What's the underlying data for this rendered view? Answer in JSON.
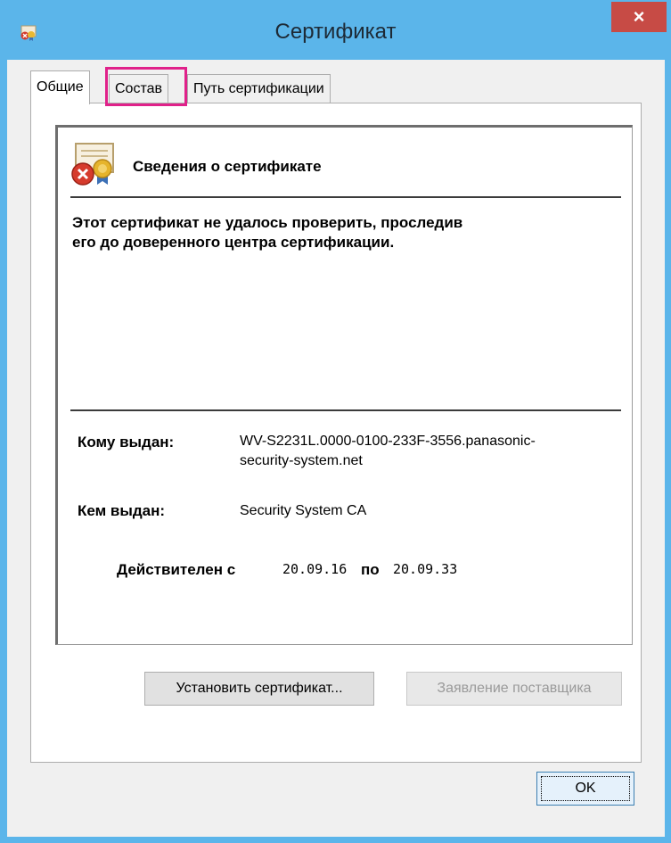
{
  "window": {
    "title": "Сертификат",
    "close_label": "×",
    "colors": {
      "frame": "#5bb5ea",
      "close": "#c74b45",
      "highlight": "#e0218a"
    }
  },
  "tabs": [
    {
      "label": "Общие",
      "active": true
    },
    {
      "label": "Состав",
      "active": false,
      "highlighted": true
    },
    {
      "label": "Путь сертификации",
      "active": false
    }
  ],
  "info": {
    "header": "Сведения о сертификате",
    "warning_line1": "Этот сертификат не удалось проверить, проследив",
    "warning_line2": "его до доверенного центра сертификации.",
    "issued_to_label": "Кому выдан:",
    "issued_to_line1": "WV-S2231L.0000-0100-233F-3556.panasonic-",
    "issued_to_line2": "security-system.net",
    "issued_by_label": "Кем выдан:",
    "issued_by": "Security System CA",
    "valid_from_label": "Действителен с",
    "valid_from": "20.09.16",
    "valid_to_label": "по",
    "valid_to": "20.09.33",
    "icon": "certificate-error-icon"
  },
  "buttons": {
    "install": "Установить сертификат...",
    "issuer_statement": "Заявление поставщика",
    "ok": "OK"
  }
}
